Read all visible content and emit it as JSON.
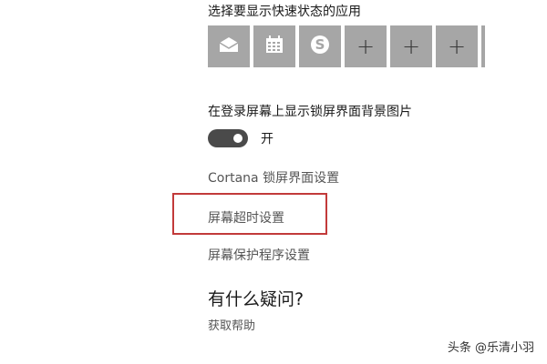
{
  "quick_status": {
    "label": "选择要显示快速状态的应用",
    "tiles": [
      {
        "icon": "mail-icon"
      },
      {
        "icon": "calendar-icon"
      },
      {
        "icon": "skype-icon"
      },
      {
        "icon": "plus-icon",
        "symbol": "+"
      },
      {
        "icon": "plus-icon",
        "symbol": "+"
      },
      {
        "icon": "plus-icon",
        "symbol": "+"
      }
    ]
  },
  "lock_background": {
    "label": "在登录屏幕上显示锁屏界面背景图片",
    "toggle_state": "开",
    "toggle_on": true
  },
  "links": {
    "cortana": "Cortana 锁屏界面设置",
    "timeout": "屏幕超时设置",
    "screensaver": "屏幕保护程序设置"
  },
  "help": {
    "title": "有什么疑问?",
    "link": "获取帮助"
  },
  "watermark": "头条 @乐清小羽",
  "colors": {
    "tile_bg": "#a6a6a6",
    "toggle_bg": "#4a4a4a",
    "highlight_border": "#c23a3a"
  }
}
